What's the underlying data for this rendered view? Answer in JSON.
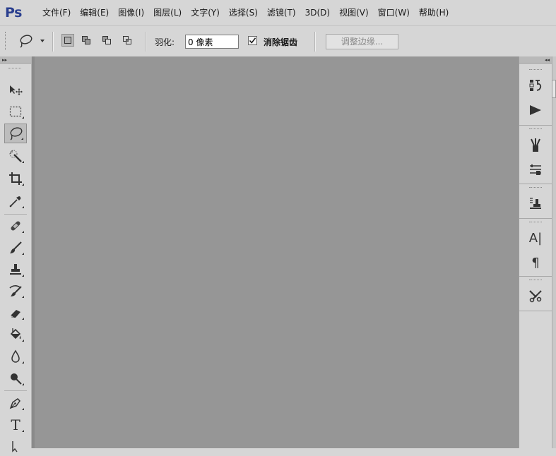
{
  "app": {
    "logo": "Ps"
  },
  "menu": {
    "items": [
      "文件(F)",
      "编辑(E)",
      "图像(I)",
      "图层(L)",
      "文字(Y)",
      "选择(S)",
      "滤镜(T)",
      "3D(D)",
      "视图(V)",
      "窗口(W)",
      "帮助(H)"
    ]
  },
  "options": {
    "feather_label": "羽化:",
    "feather_value": "0 像素",
    "antialias_label": "消除锯齿",
    "antialias_checked": true,
    "refine_edge_label": "调整边缘..."
  },
  "tools": [
    {
      "name": "move-tool",
      "icon": "move-icon"
    },
    {
      "name": "rectangular-marquee-tool",
      "icon": "marquee-icon"
    },
    {
      "name": "lasso-tool",
      "icon": "lasso-icon",
      "active": true
    },
    {
      "name": "quick-selection-tool",
      "icon": "magic-wand-icon"
    },
    {
      "name": "crop-tool",
      "icon": "crop-icon"
    },
    {
      "name": "eyedropper-tool",
      "icon": "eyedropper-icon"
    },
    {
      "name": "healing-brush-tool",
      "icon": "bandage-icon"
    },
    {
      "name": "brush-tool",
      "icon": "brush-icon"
    },
    {
      "name": "clone-stamp-tool",
      "icon": "stamp-icon"
    },
    {
      "name": "history-brush-tool",
      "icon": "history-brush-icon"
    },
    {
      "name": "eraser-tool",
      "icon": "eraser-icon"
    },
    {
      "name": "paint-bucket-tool",
      "icon": "paint-bucket-icon"
    },
    {
      "name": "blur-tool",
      "icon": "blur-drop-icon"
    },
    {
      "name": "dodge-tool",
      "icon": "dodge-icon"
    },
    {
      "name": "pen-tool",
      "icon": "pen-icon"
    },
    {
      "name": "type-tool",
      "icon": "type-icon",
      "glyph": "T"
    },
    {
      "name": "path-selection-tool",
      "icon": "path-select-icon"
    }
  ],
  "right_panel": {
    "icons": [
      "history-icon",
      "actions-play-icon",
      "brush-presets-icon",
      "adjustments-icon",
      "clone-source-icon",
      "character-icon",
      "paragraph-icon",
      "tool-presets-icon"
    ],
    "character_glyph": "A|",
    "paragraph_glyph": "¶"
  },
  "colors": {
    "chrome": "#d6d6d6",
    "canvas": "#969696",
    "logo": "#2a3f8f"
  }
}
